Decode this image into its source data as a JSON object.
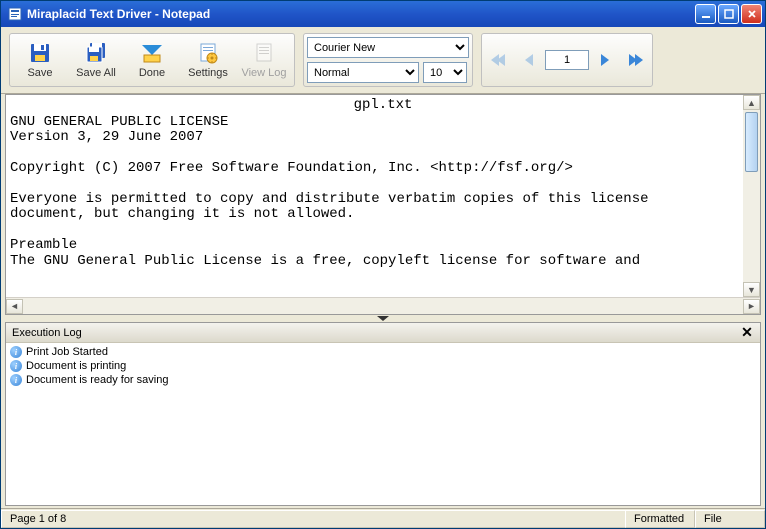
{
  "window": {
    "title": "Miraplacid Text Driver - Notepad"
  },
  "toolbar": {
    "save": "Save",
    "save_all": "Save All",
    "done": "Done",
    "settings": "Settings",
    "view_log": "View Log"
  },
  "font": {
    "family": "Courier New",
    "style": "Normal",
    "size": "10"
  },
  "pager": {
    "current": "1"
  },
  "document": {
    "filename": "gpl.txt",
    "body": "GNU GENERAL PUBLIC LICENSE\nVersion 3, 29 June 2007\n\nCopyright (C) 2007 Free Software Foundation, Inc. <http://fsf.org/>\n\nEveryone is permitted to copy and distribute verbatim copies of this license\ndocument, but changing it is not allowed.\n\nPreamble\nThe GNU General Public License is a free, copyleft license for software and"
  },
  "log": {
    "title": "Execution Log",
    "entries": [
      "Print Job Started",
      "Document is printing",
      "Document is ready for saving"
    ]
  },
  "status": {
    "page": "Page 1 of 8",
    "view": "Formatted",
    "source": "File"
  }
}
